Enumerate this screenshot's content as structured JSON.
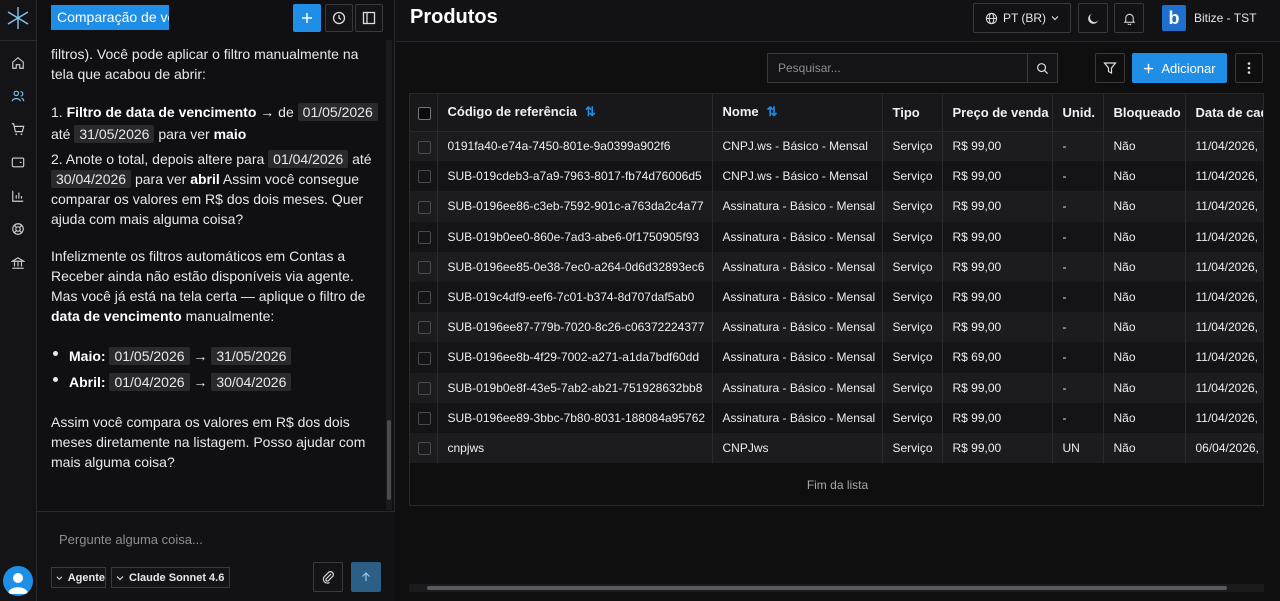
{
  "app": {
    "org_name": "Bitize - TST",
    "org_logo_letter": "b",
    "accent": "#1f8ee6"
  },
  "rail": {
    "items": [
      "home-icon",
      "users-icon",
      "cart-icon",
      "wallet-icon",
      "chart-icon",
      "support-icon",
      "bank-icon"
    ]
  },
  "chat": {
    "title": "Comparação de ve",
    "messages": {
      "p1": "filtros). Você pode aplicar o filtro manualmente na tela que acabou de abrir:",
      "s1_num": "1. ",
      "s1_bold": "Filtro de data de vencimento",
      "s1_arrow": " → de ",
      "s1_date1": "01/05/2026",
      "s1_ate": "até ",
      "s1_date2": "31/05/2026",
      "s1_tail": " para ver ",
      "s1_month": "maio",
      "s2_text": "2. Anote o total, depois altere para ",
      "s2_date1": "01/04/2026",
      "s2_ate": " até ",
      "s2_date2": "30/04/2026",
      "s2_tail1": " para ver ",
      "s2_month": "abril",
      "s2_tail2": " Assim você consegue comparar os valores em R$ dos dois meses. Quer ajuda com mais alguma coisa?",
      "p3_a": "Infelizmente os filtros automáticos em Contas a Receber ainda não estão disponíveis via agente. Mas você já está na tela certa — aplique o filtro de ",
      "p3_bold": "data de vencimento",
      "p3_b": " manualmente:",
      "b1_label": "Maio:",
      "b1_d1": "01/05/2026",
      "b1_arrow": "→",
      "b1_d2": "31/05/2026",
      "b2_label": "Abril:",
      "b2_d1": "01/04/2026",
      "b2_arrow": "→",
      "b2_d2": "30/04/2026",
      "p4": "Assim você compara os valores em R$ dos dois meses diretamente na listagem. Posso ajudar com mais alguma coisa?"
    },
    "composer": {
      "placeholder": "Pergunte alguma coisa...",
      "mode": "Agente",
      "model": "Claude Sonnet 4.6"
    }
  },
  "main": {
    "title": "Produtos",
    "language": "PT (BR)",
    "search_placeholder": "Pesquisar...",
    "add_label": "Adicionar",
    "end_of_list": "Fim da lista",
    "columns": [
      "Código de referência",
      "Nome",
      "Tipo",
      "Preço de venda",
      "Unid.",
      "Bloqueado",
      "Data de cad"
    ],
    "rows": [
      [
        "0191fa40-e74a-7450-801e-9a0399a902f6",
        "CNPJ.ws - Básico - Mensal",
        "Serviço",
        "R$ 99,00",
        "-",
        "Não",
        "11/04/2026,"
      ],
      [
        "SUB-019cdeb3-a7a9-7963-8017-fb74d76006d5",
        "CNPJ.ws - Básico - Mensal",
        "Serviço",
        "R$ 99,00",
        "-",
        "Não",
        "11/04/2026,"
      ],
      [
        "SUB-0196ee86-c3eb-7592-901c-a763da2c4a77",
        "Assinatura - Básico - Mensal",
        "Serviço",
        "R$ 99,00",
        "-",
        "Não",
        "11/04/2026,"
      ],
      [
        "SUB-019b0ee0-860e-7ad3-abe6-0f1750905f93",
        "Assinatura - Básico - Mensal",
        "Serviço",
        "R$ 99,00",
        "-",
        "Não",
        "11/04/2026,"
      ],
      [
        "SUB-0196ee85-0e38-7ec0-a264-0d6d32893ec6",
        "Assinatura - Básico - Mensal",
        "Serviço",
        "R$ 99,00",
        "-",
        "Não",
        "11/04/2026,"
      ],
      [
        "SUB-019c4df9-eef6-7c01-b374-8d707daf5ab0",
        "Assinatura - Básico - Mensal",
        "Serviço",
        "R$ 99,00",
        "-",
        "Não",
        "11/04/2026,"
      ],
      [
        "SUB-0196ee87-779b-7020-8c26-c06372224377",
        "Assinatura - Básico - Mensal",
        "Serviço",
        "R$ 99,00",
        "-",
        "Não",
        "11/04/2026,"
      ],
      [
        "SUB-0196ee8b-4f29-7002-a271-a1da7bdf60dd",
        "Assinatura - Básico - Mensal",
        "Serviço",
        "R$ 69,00",
        "-",
        "Não",
        "11/04/2026,"
      ],
      [
        "SUB-019b0e8f-43e5-7ab2-ab21-751928632bb8",
        "Assinatura - Básico - Mensal",
        "Serviço",
        "R$ 99,00",
        "-",
        "Não",
        "11/04/2026,"
      ],
      [
        "SUB-0196ee89-3bbc-7b80-8031-188084a95762",
        "Assinatura - Básico - Mensal",
        "Serviço",
        "R$ 99,00",
        "-",
        "Não",
        "11/04/2026,"
      ],
      [
        "cnpjws",
        "CNPJws",
        "Serviço",
        "R$ 99,00",
        "UN",
        "Não",
        "06/04/2026,"
      ]
    ]
  }
}
